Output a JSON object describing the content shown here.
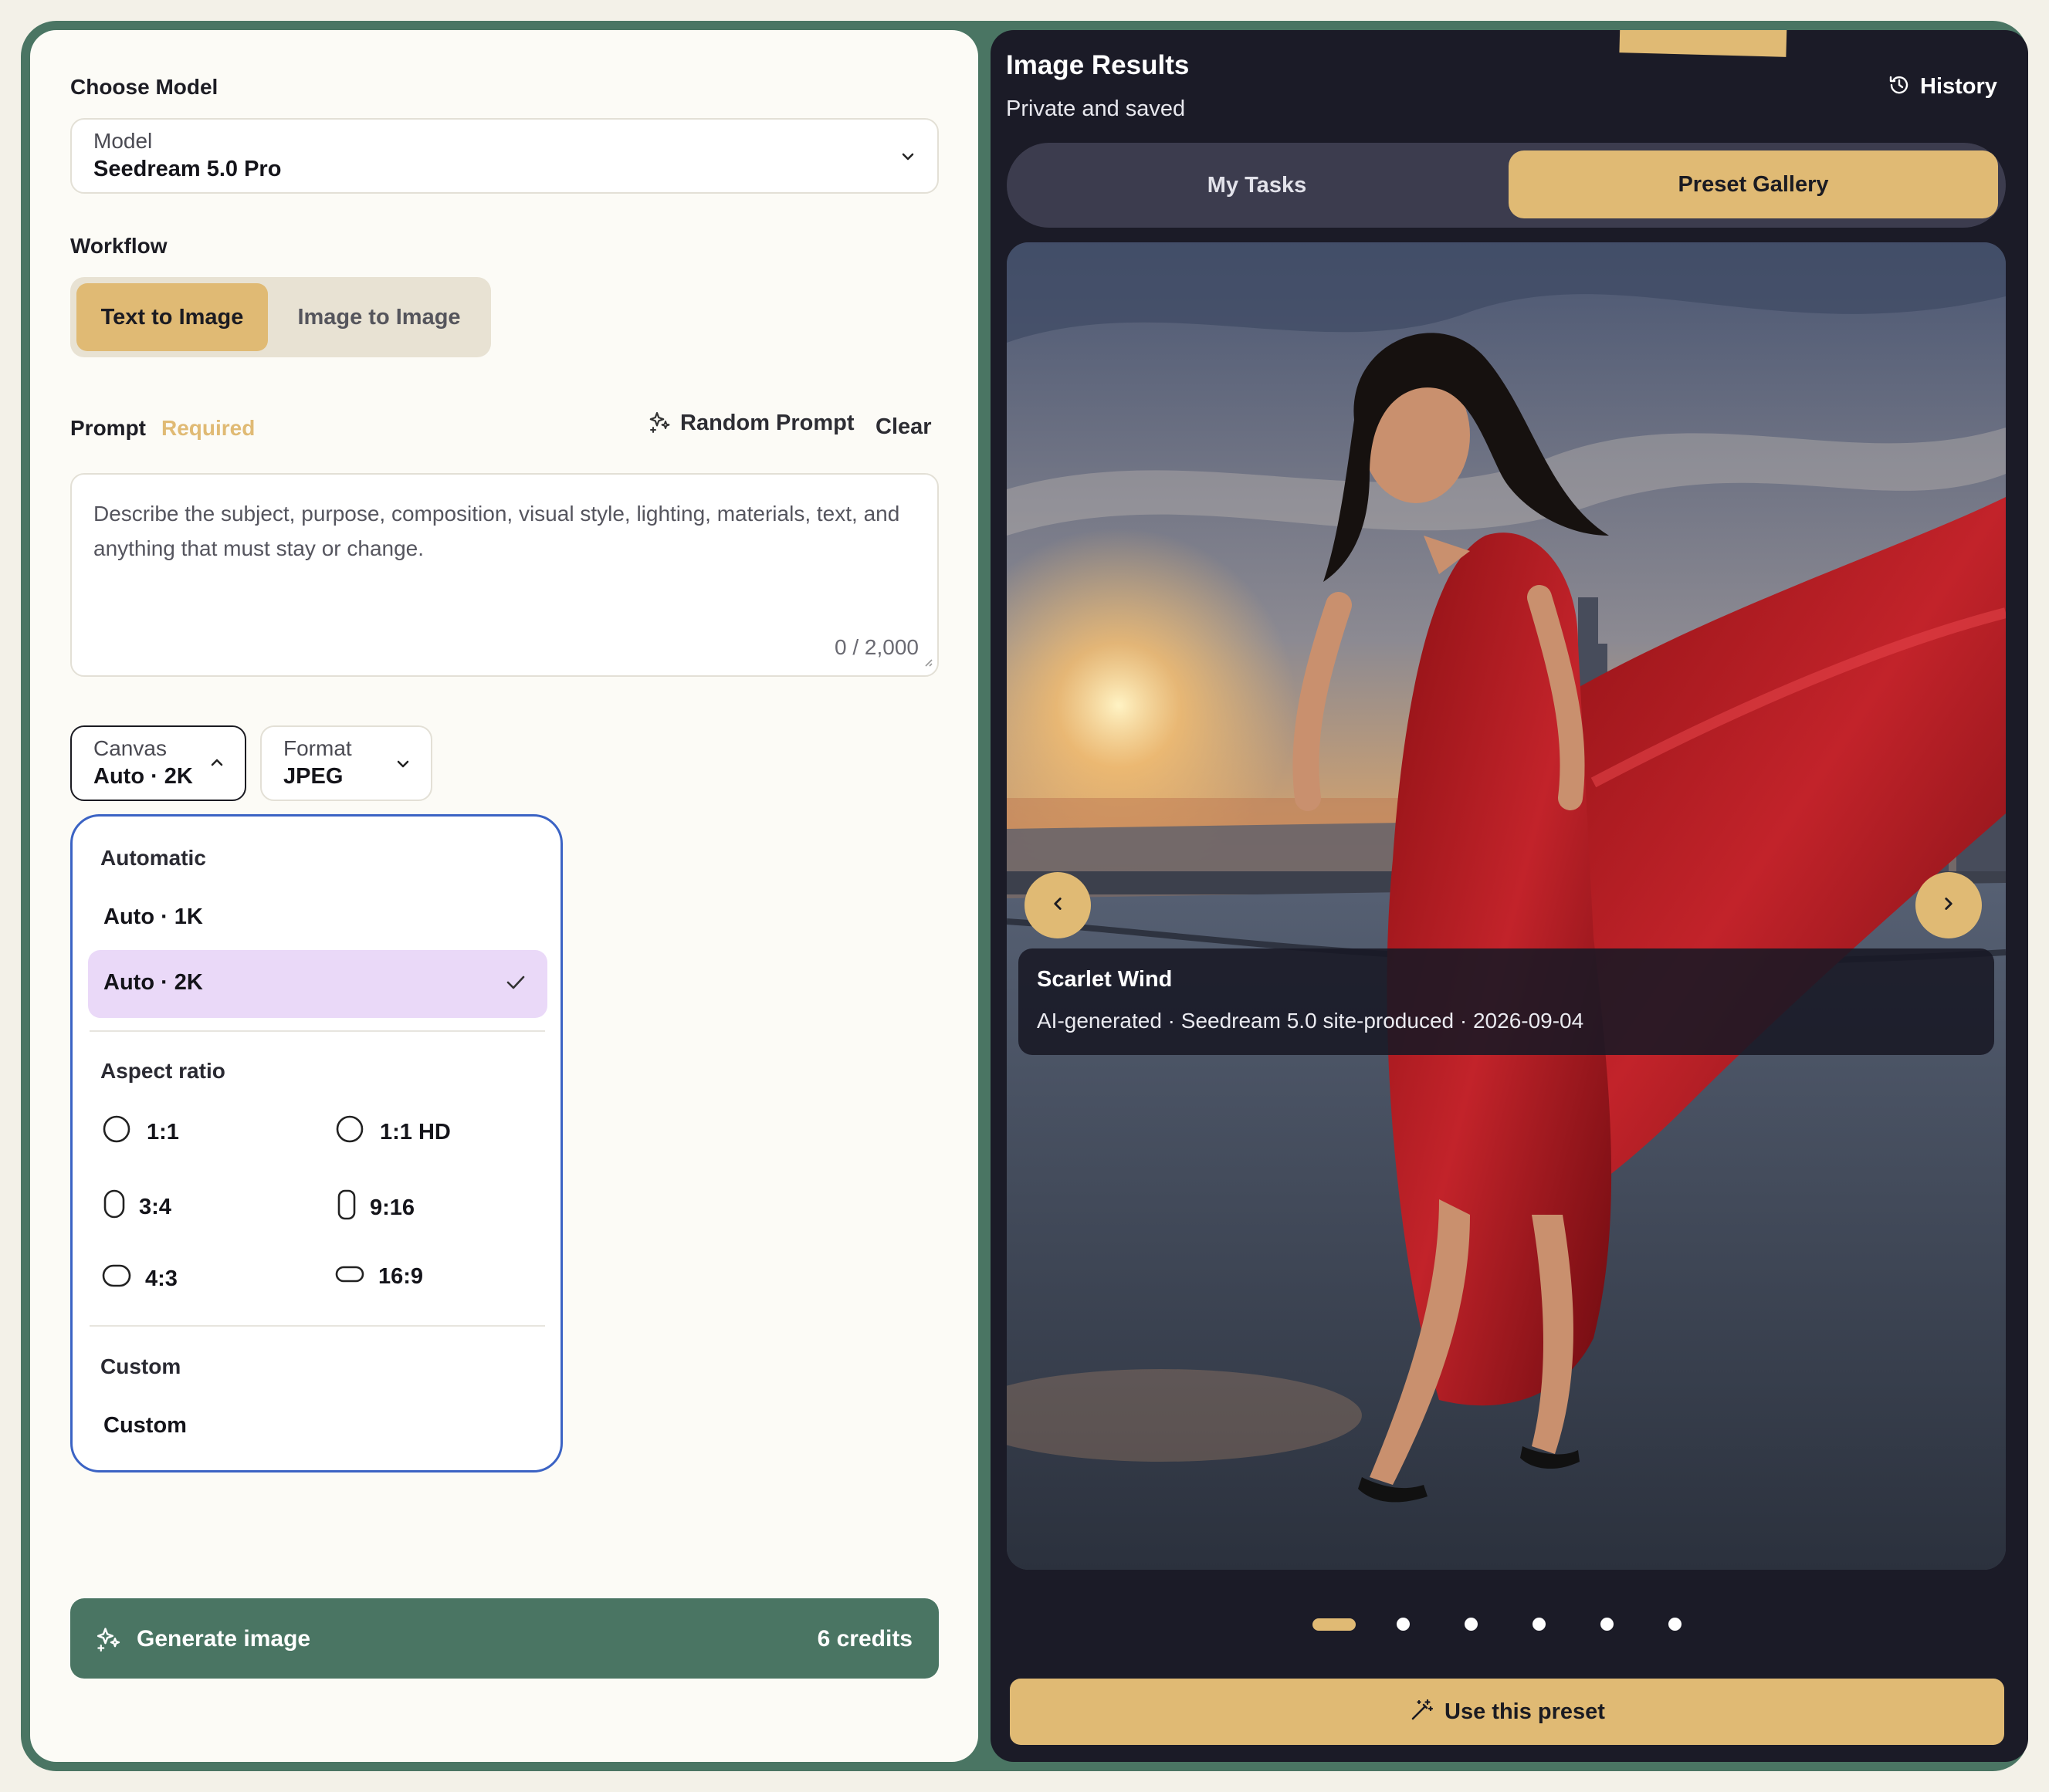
{
  "left": {
    "choose_model_label": "Choose Model",
    "model": {
      "label": "Model",
      "value": "Seedream 5.0 Pro"
    },
    "workflow_label": "Workflow",
    "workflow_tabs": [
      "Text to Image",
      "Image to Image"
    ],
    "workflow_active": "Text to Image",
    "prompt": {
      "label": "Prompt",
      "required": "Required",
      "random_label": "Random Prompt",
      "clear_label": "Clear",
      "placeholder": "Describe the subject, purpose, composition, visual style, lighting, materials, text, and anything that must stay or change.",
      "counter": "0 / 2,000"
    },
    "canvas": {
      "label": "Canvas",
      "value": "Auto · 2K"
    },
    "format": {
      "label": "Format",
      "value": "JPEG"
    },
    "dropdown": {
      "automatic_heading": "Automatic",
      "auto_options": [
        "Auto · 1K",
        "Auto · 2K"
      ],
      "selected": "Auto · 2K",
      "aspect_heading": "Aspect ratio",
      "ratios": [
        "1:1",
        "1:1 HD",
        "3:4",
        "9:16",
        "4:3",
        "16:9"
      ],
      "custom_heading": "Custom",
      "custom_option": "Custom"
    },
    "generate": {
      "label": "Generate image",
      "credits": "6 credits"
    }
  },
  "right": {
    "title": "Image Results",
    "subtitle": "Private and saved",
    "history_label": "History",
    "tabs": [
      "My Tasks",
      "Preset Gallery"
    ],
    "active_tab": "Preset Gallery",
    "preset": {
      "title": "Scarlet Wind",
      "meta": "AI-generated · Seedream 5.0 site-produced · 2026-09-04"
    },
    "carousel_total": 6,
    "carousel_active": 1,
    "use_preset_label": "Use this preset"
  },
  "colors": {
    "accent": "#e0ba74",
    "green": "#4a7563",
    "dark": "#1b1b27",
    "selected": "#ead9f8",
    "focus": "#3b63c4"
  }
}
